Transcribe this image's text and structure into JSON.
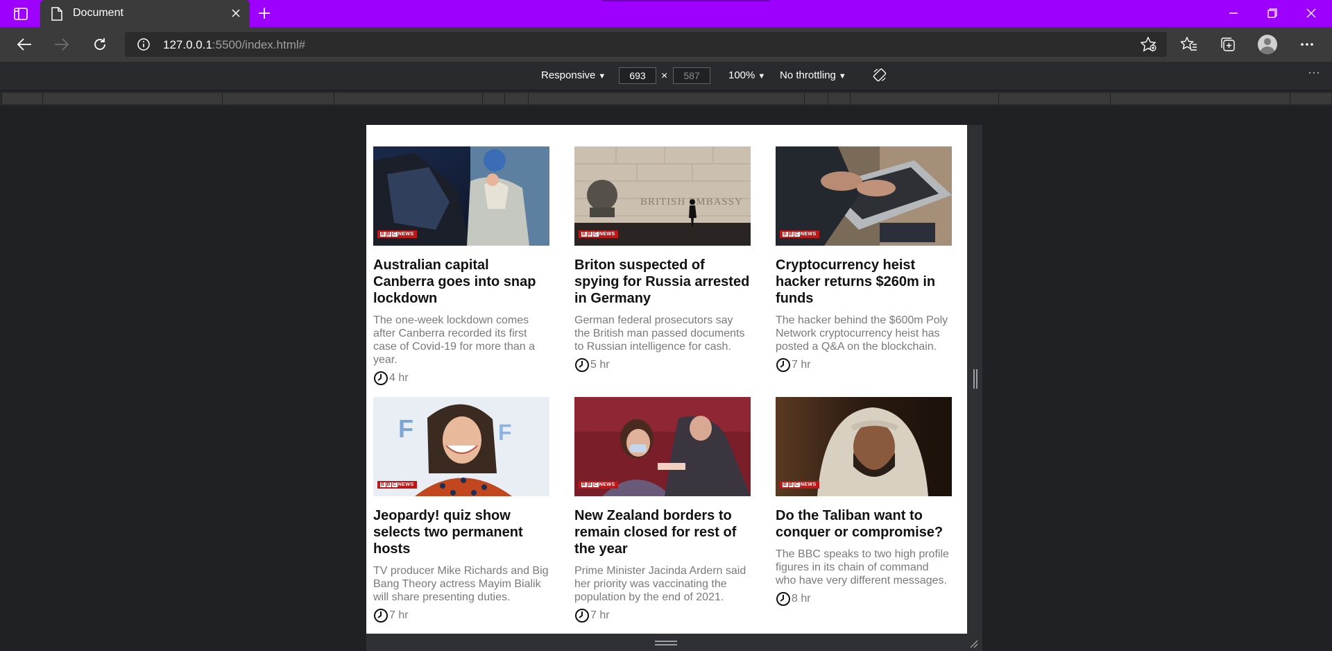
{
  "browser": {
    "tab_title": "Document",
    "url_host": "127.0.0.1",
    "url_rest": ":5500/index.html#",
    "accent_color": "#9d00ff"
  },
  "devtools": {
    "device": "Responsive",
    "width": "693",
    "height": "587",
    "zoom": "100%",
    "throttling": "No throttling",
    "times": "×",
    "more": "⋯"
  },
  "news": {
    "source_badge": "NEWS",
    "articles": [
      {
        "title": "Australian capital Canberra goes into snap lockdown",
        "summary": "The one-week lockdown comes after Canberra recorded its first case of Covid-19 for more than a year.",
        "time": "4 hr",
        "image": "healthcare-worker-testing-driver"
      },
      {
        "title": "Briton suspected of spying for Russia arrested in Germany",
        "summary": "German federal prosecutors say the British man passed documents to Russian intelligence for cash.",
        "time": "5 hr",
        "image": "british-embassy-wall",
        "image_text": "BRITISH EMBASSY"
      },
      {
        "title": "Cryptocurrency heist hacker returns $260m in funds",
        "summary": "The hacker behind the $600m Poly Network cryptocurrency heist has posted a Q&A on the blockchain.",
        "time": "7 hr",
        "image": "hands-typing-laptop"
      },
      {
        "title": "Jeopardy! quiz show selects two permanent hosts",
        "summary": "TV producer Mike Richards and Big Bang Theory actress Mayim Bialik will share presenting duties.",
        "time": "7 hr",
        "image": "smiling-woman-portrait"
      },
      {
        "title": "New Zealand borders to remain closed for rest of the year",
        "summary": "Prime Minister Jacinda Ardern said her priority was vaccinating the population by the end of 2021.",
        "time": "7 hr",
        "image": "vaccination-scene"
      },
      {
        "title": "Do the Taliban want to conquer or compromise?",
        "summary": "The BBC speaks to two high profile figures in its chain of command who have very different messages.",
        "time": "8 hr",
        "image": "man-in-turban"
      }
    ]
  }
}
